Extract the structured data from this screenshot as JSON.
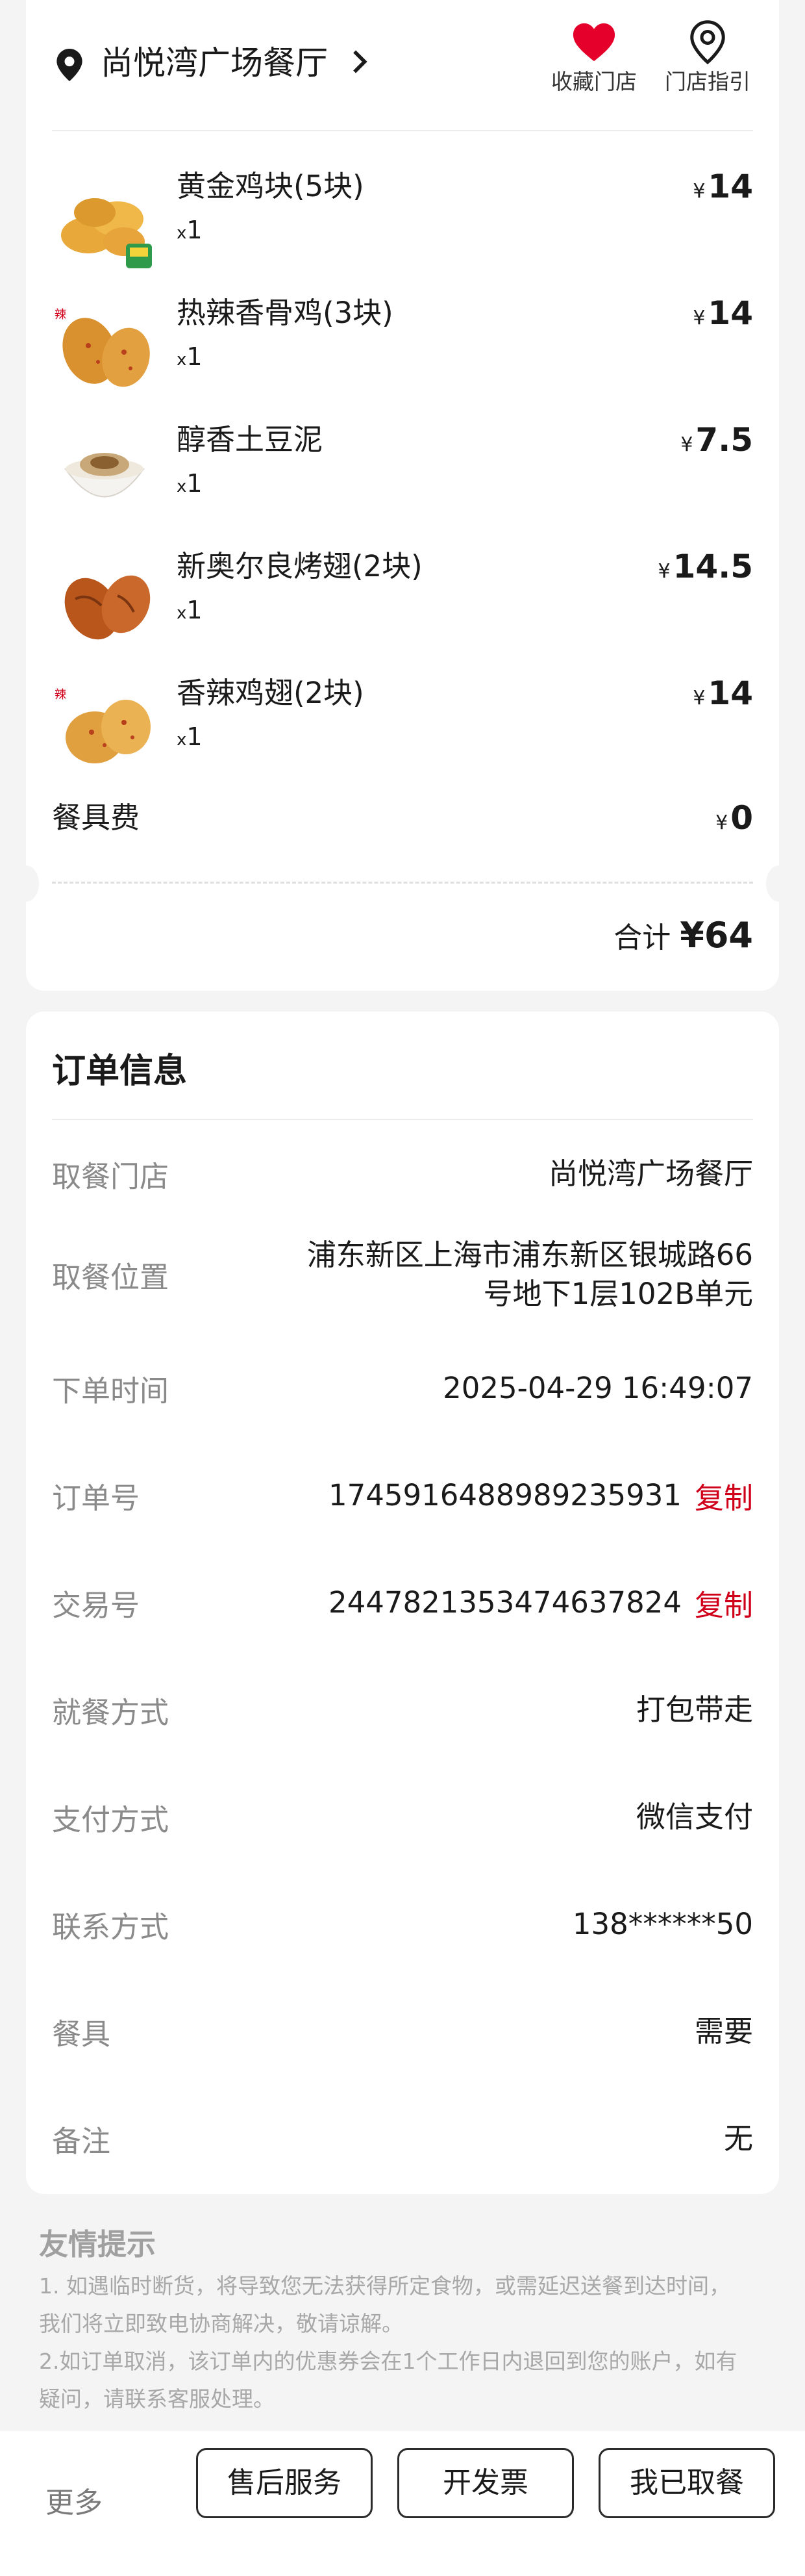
{
  "store": {
    "name": "尚悦湾广场餐厅",
    "favorite_label": "收藏门店",
    "guide_label": "门店指引",
    "favorite_color": "#e5002b"
  },
  "items": [
    {
      "name": "黄金鸡块(5块)",
      "qty_prefix": "x",
      "qty": "1",
      "currency": "¥",
      "price": "14",
      "icon": "chicken-nuggets-image"
    },
    {
      "name": "热辣香骨鸡(3块)",
      "qty_prefix": "x",
      "qty": "1",
      "currency": "¥",
      "price": "14",
      "icon": "spicy-chicken-image"
    },
    {
      "name": "醇香土豆泥",
      "qty_prefix": "x",
      "qty": "1",
      "currency": "¥",
      "price": "7.5",
      "icon": "mashed-potato-image"
    },
    {
      "name": "新奥尔良烤翅(2块)",
      "qty_prefix": "x",
      "qty": "1",
      "currency": "¥",
      "price": "14.5",
      "icon": "roast-wings-image"
    },
    {
      "name": "香辣鸡翅(2块)",
      "qty_prefix": "x",
      "qty": "1",
      "currency": "¥",
      "price": "14",
      "icon": "spicy-wings-image"
    }
  ],
  "tableware_fee": {
    "label": "餐具费",
    "currency": "¥",
    "price": "0"
  },
  "total": {
    "label": "合计",
    "value": "¥64"
  },
  "order_info": {
    "title": "订单信息",
    "rows": [
      {
        "key": "取餐门店",
        "value": "尚悦湾广场餐厅"
      },
      {
        "key": "取餐位置",
        "value": "浦东新区上海市浦东新区银城路66号地下1层102B单元"
      },
      {
        "key": "下单时间",
        "value": "2025-04-29 16:49:07"
      },
      {
        "key": "订单号",
        "value": "1745916488989235931",
        "action": "复制"
      },
      {
        "key": "交易号",
        "value": "2447821353474637824",
        "action": "复制"
      },
      {
        "key": "就餐方式",
        "value": "打包带走"
      },
      {
        "key": "支付方式",
        "value": "微信支付"
      },
      {
        "key": "联系方式",
        "value": "138******50"
      },
      {
        "key": "餐具",
        "value": "需要"
      },
      {
        "key": "备注",
        "value": "无"
      }
    ]
  },
  "tips": {
    "title": "友情提示",
    "lines": [
      "1. 如遇临时断货，将导致您无法获得所定食物，或需延迟送餐到达时间，",
      "我们将立即致电协商解决，敬请谅解。",
      "2.如订单取消，该订单内的优惠券会在1个工作日内退回到您的账户，如有",
      "疑问，请联系客服处理。"
    ]
  },
  "bottom_bar": {
    "more_label": "更多",
    "after_sales_label": "售后服务",
    "invoice_label": "开发票",
    "picked_up_label": "我已取餐"
  },
  "colors": {
    "accent_red": "#d0001b",
    "background": "#f4f4f4"
  }
}
